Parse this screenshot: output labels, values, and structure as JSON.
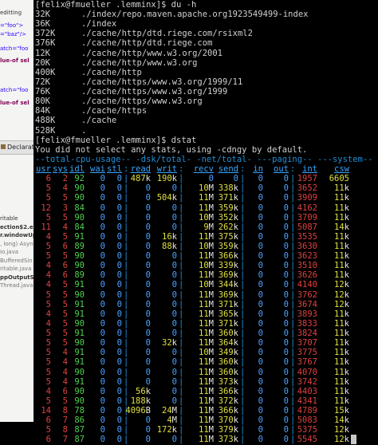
{
  "ide": {
    "code_lines": [
      {
        "text": "editting",
        "cls": ""
      },
      {
        "text": "=\"foo\">",
        "cls": "c-blue"
      },
      {
        "text": "=\"baz\"/>",
        "cls": "c-blue"
      },
      {
        "text": "atch=\"foo",
        "cls": "c-blue"
      },
      {
        "text": "lue-of sel",
        "cls": "c-purple"
      },
      {
        "text": "",
        "cls": ""
      },
      {
        "text": "",
        "cls": ""
      },
      {
        "text": "atch=\"foo",
        "cls": "c-blue"
      },
      {
        "text": "lue-of sel",
        "cls": "c-purple"
      }
    ],
    "tab_label": "Declaratio",
    "panel_lines": [
      {
        "text": "ritable",
        "cls": ""
      },
      {
        "text": "ection$2.exe",
        "cls": "bold"
      },
      {
        "text": "r.windowUp",
        "cls": "bold"
      },
      {
        "text": ", long) Asyn",
        "cls": "gray"
      },
      {
        "text": "io.java",
        "cls": "gray"
      },
      {
        "text": "BufferedSin",
        "cls": "gray"
      },
      {
        "text": "ritable.java",
        "cls": "gray"
      },
      {
        "text": "ppOutputSt",
        "cls": "bold"
      },
      {
        "text": "Thread.java",
        "cls": "gray"
      }
    ]
  },
  "terminal": {
    "prompt1": "[felix@fmueller .lemminx]$ du -h",
    "du_lines": [
      {
        "size": "32K",
        "path": "./index/repo.maven.apache.org1923549499-index"
      },
      {
        "size": "36K",
        "path": "./index"
      },
      {
        "size": "372K",
        "path": "./cache/http/dtd.riege.com/rsixml2"
      },
      {
        "size": "376K",
        "path": "./cache/http/dtd.riege.com"
      },
      {
        "size": "12K",
        "path": "./cache/http/www.w3.org/2001"
      },
      {
        "size": "20K",
        "path": "./cache/http/www.w3.org"
      },
      {
        "size": "400K",
        "path": "./cache/http"
      },
      {
        "size": "72K",
        "path": "./cache/https/www.w3.org/1999/11"
      },
      {
        "size": "76K",
        "path": "./cache/https/www.w3.org/1999"
      },
      {
        "size": "80K",
        "path": "./cache/https/www.w3.org"
      },
      {
        "size": "84K",
        "path": "./cache/https"
      },
      {
        "size": "488K",
        "path": "./cache"
      },
      {
        "size": "528K",
        "path": "."
      }
    ],
    "prompt2": "[felix@fmueller .lemminx]$ dstat",
    "dstat_msg": "You did not select any stats, using -cdngy by default.",
    "group_header": "--total-cpu-usage-- -dsk/total- -net/total- ---paging-- ---system--",
    "columns": [
      "usr",
      "sys",
      "idl",
      "wai",
      "stl",
      "read",
      "writ",
      "recv",
      "send",
      "in",
      "out",
      "int",
      "csw"
    ],
    "rows": [
      [
        "6",
        "2",
        "92",
        "0",
        "0",
        "487k",
        "190k",
        "0",
        "0",
        "0",
        "0",
        "1957",
        "6605"
      ],
      [
        "5",
        "4",
        "90",
        "0",
        "0",
        "0",
        "0",
        "10M",
        "338k",
        "0",
        "0",
        "3652",
        "11k"
      ],
      [
        "5",
        "5",
        "90",
        "0",
        "0",
        "0",
        "504k",
        "11M",
        "371k",
        "0",
        "0",
        "3909",
        "11k"
      ],
      [
        "12",
        "3",
        "84",
        "0",
        "0",
        "0",
        "0",
        "11M",
        "359k",
        "0",
        "0",
        "4162",
        "11k"
      ],
      [
        "5",
        "5",
        "90",
        "0",
        "0",
        "0",
        "0",
        "10M",
        "352k",
        "0",
        "0",
        "3709",
        "11k"
      ],
      [
        "11",
        "4",
        "84",
        "0",
        "0",
        "0",
        "0",
        "9M",
        "262k",
        "0",
        "0",
        "5087",
        "14k"
      ],
      [
        "4",
        "5",
        "91",
        "0",
        "0",
        "0",
        "16k",
        "11M",
        "375k",
        "0",
        "0",
        "3535",
        "11k"
      ],
      [
        "5",
        "6",
        "89",
        "0",
        "0",
        "0",
        "88k",
        "10M",
        "359k",
        "0",
        "0",
        "3630",
        "11k"
      ],
      [
        "5",
        "5",
        "90",
        "0",
        "0",
        "0",
        "0",
        "11M",
        "366k",
        "0",
        "0",
        "3623",
        "11k"
      ],
      [
        "4",
        "6",
        "90",
        "0",
        "0",
        "0",
        "0",
        "10M",
        "339k",
        "0",
        "0",
        "3510",
        "11k"
      ],
      [
        "4",
        "6",
        "89",
        "0",
        "0",
        "0",
        "0",
        "11M",
        "369k",
        "0",
        "0",
        "3626",
        "11k"
      ],
      [
        "4",
        "5",
        "91",
        "0",
        "0",
        "0",
        "0",
        "10M",
        "344k",
        "0",
        "0",
        "4140",
        "12k"
      ],
      [
        "5",
        "5",
        "90",
        "0",
        "0",
        "0",
        "0",
        "11M",
        "369k",
        "0",
        "0",
        "3762",
        "12k"
      ],
      [
        "5",
        "5",
        "91",
        "0",
        "0",
        "0",
        "0",
        "11M",
        "371k",
        "0",
        "0",
        "3674",
        "12k"
      ],
      [
        "4",
        "5",
        "91",
        "0",
        "0",
        "0",
        "0",
        "11M",
        "365k",
        "0",
        "0",
        "3893",
        "11k"
      ],
      [
        "4",
        "5",
        "90",
        "0",
        "0",
        "0",
        "0",
        "11M",
        "371k",
        "0",
        "0",
        "3833",
        "11k"
      ],
      [
        "5",
        "5",
        "91",
        "0",
        "0",
        "0",
        "0",
        "11M",
        "360k",
        "0",
        "0",
        "3824",
        "11k"
      ],
      [
        "5",
        "5",
        "90",
        "0",
        "0",
        "0",
        "32k",
        "11M",
        "364k",
        "0",
        "0",
        "3707",
        "11k"
      ],
      [
        "5",
        "4",
        "91",
        "0",
        "0",
        "0",
        "0",
        "10M",
        "349k",
        "0",
        "0",
        "3775",
        "11k"
      ],
      [
        "5",
        "4",
        "91",
        "0",
        "0",
        "0",
        "0",
        "11M",
        "360k",
        "0",
        "0",
        "3767",
        "11k"
      ],
      [
        "5",
        "4",
        "90",
        "0",
        "0",
        "0",
        "0",
        "11M",
        "360k",
        "0",
        "0",
        "4070",
        "11k"
      ],
      [
        "5",
        "4",
        "91",
        "0",
        "0",
        "0",
        "0",
        "11M",
        "373k",
        "0",
        "0",
        "3742",
        "11k"
      ],
      [
        "4",
        "6",
        "90",
        "0",
        "0",
        "56k",
        "0",
        "11M",
        "366k",
        "0",
        "0",
        "4403",
        "11k"
      ],
      [
        "5",
        "5",
        "90",
        "0",
        "0",
        "188k",
        "0",
        "11M",
        "372k",
        "0",
        "0",
        "4341",
        "11k"
      ],
      [
        "14",
        "8",
        "78",
        "0",
        "0",
        "4096B",
        "24M",
        "11M",
        "366k",
        "0",
        "0",
        "4789",
        "15k"
      ],
      [
        "6",
        "7",
        "86",
        "0",
        "0",
        "0",
        "4M",
        "11M",
        "370k",
        "0",
        "0",
        "5083",
        "14k"
      ],
      [
        "5",
        "8",
        "87",
        "0",
        "0",
        "0",
        "172k",
        "11M",
        "379k",
        "0",
        "0",
        "5375",
        "12k"
      ],
      [
        "6",
        "7",
        "87",
        "0",
        "0",
        "0",
        "0",
        "11M",
        "373k",
        "0",
        "0",
        "5545",
        "12k"
      ]
    ]
  }
}
